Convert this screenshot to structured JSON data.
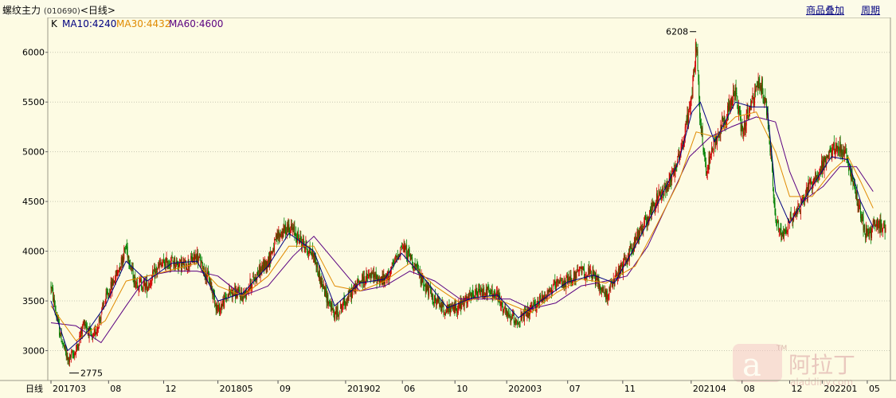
{
  "header": {
    "title_name": "螺纹主力",
    "title_code": "(010690)",
    "title_period": "<日线>",
    "link_overlay": "商品叠加",
    "link_period": "周期"
  },
  "legend": {
    "k_label": "K",
    "ma10": "MA10:4240",
    "ma30": "MA30:4432",
    "ma60": "MA60:4600"
  },
  "colors": {
    "background": "#fdfbe3",
    "up": "#d00000",
    "down": "#008000",
    "ma10": "#000080",
    "ma30": "#e08a00",
    "ma60": "#5a0080",
    "grid": "#c8c8b4"
  },
  "watermark": {
    "text": "阿拉丁",
    "url": "aladdiny.com",
    "tm": "TM"
  },
  "chart_data": {
    "type": "candlestick",
    "ylim": [
      2700,
      6350
    ],
    "ytick_values": [
      3000,
      3500,
      4000,
      4500,
      5000,
      5500,
      6000
    ],
    "ytick_labels": [
      "3000",
      "3500",
      "4000",
      "4500",
      "5000",
      "5500",
      "6000"
    ],
    "x_axis_prefix": "日线",
    "x_tick_labels": [
      {
        "label": "201703",
        "t": 0.0
      },
      {
        "label": "08",
        "t": 0.069
      },
      {
        "label": "12",
        "t": 0.135
      },
      {
        "label": "201805",
        "t": 0.2
      },
      {
        "label": "09",
        "t": 0.272
      },
      {
        "label": "201902",
        "t": 0.353
      },
      {
        "label": "06",
        "t": 0.421
      },
      {
        "label": "10",
        "t": 0.484
      },
      {
        "label": "202003",
        "t": 0.546
      },
      {
        "label": "07",
        "t": 0.619
      },
      {
        "label": "11",
        "t": 0.685
      },
      {
        "label": "202104",
        "t": 0.767
      },
      {
        "label": "08",
        "t": 0.828
      },
      {
        "label": "12",
        "t": 0.885
      },
      {
        "label": "202201",
        "t": 0.924
      },
      {
        "label": "05",
        "t": 0.978
      }
    ],
    "close_path": [
      [
        0.0,
        3650
      ],
      [
        0.01,
        3200
      ],
      [
        0.02,
        2900
      ],
      [
        0.03,
        3000
      ],
      [
        0.04,
        3300
      ],
      [
        0.05,
        3100
      ],
      [
        0.065,
        3500
      ],
      [
        0.08,
        3800
      ],
      [
        0.09,
        4050
      ],
      [
        0.1,
        3700
      ],
      [
        0.115,
        3650
      ],
      [
        0.13,
        3850
      ],
      [
        0.145,
        3900
      ],
      [
        0.16,
        3850
      ],
      [
        0.175,
        3950
      ],
      [
        0.19,
        3700
      ],
      [
        0.2,
        3400
      ],
      [
        0.215,
        3600
      ],
      [
        0.23,
        3550
      ],
      [
        0.245,
        3750
      ],
      [
        0.26,
        3900
      ],
      [
        0.272,
        4150
      ],
      [
        0.285,
        4250
      ],
      [
        0.3,
        4100
      ],
      [
        0.315,
        3950
      ],
      [
        0.325,
        3650
      ],
      [
        0.34,
        3350
      ],
      [
        0.353,
        3500
      ],
      [
        0.37,
        3700
      ],
      [
        0.385,
        3750
      ],
      [
        0.4,
        3700
      ],
      [
        0.41,
        3850
      ],
      [
        0.42,
        4050
      ],
      [
        0.43,
        3950
      ],
      [
        0.445,
        3700
      ],
      [
        0.46,
        3500
      ],
      [
        0.475,
        3400
      ],
      [
        0.49,
        3450
      ],
      [
        0.505,
        3550
      ],
      [
        0.52,
        3600
      ],
      [
        0.535,
        3550
      ],
      [
        0.546,
        3350
      ],
      [
        0.56,
        3300
      ],
      [
        0.575,
        3400
      ],
      [
        0.59,
        3550
      ],
      [
        0.605,
        3650
      ],
      [
        0.619,
        3700
      ],
      [
        0.635,
        3800
      ],
      [
        0.65,
        3750
      ],
      [
        0.665,
        3550
      ],
      [
        0.675,
        3700
      ],
      [
        0.685,
        3850
      ],
      [
        0.7,
        4100
      ],
      [
        0.712,
        4300
      ],
      [
        0.725,
        4500
      ],
      [
        0.74,
        4700
      ],
      [
        0.752,
        4950
      ],
      [
        0.76,
        5200
      ],
      [
        0.768,
        5600
      ],
      [
        0.773,
        6100
      ],
      [
        0.778,
        5300
      ],
      [
        0.785,
        4800
      ],
      [
        0.795,
        5100
      ],
      [
        0.81,
        5400
      ],
      [
        0.82,
        5600
      ],
      [
        0.828,
        5200
      ],
      [
        0.84,
        5500
      ],
      [
        0.85,
        5700
      ],
      [
        0.858,
        5400
      ],
      [
        0.863,
        4900
      ],
      [
        0.868,
        4300
      ],
      [
        0.875,
        4150
      ],
      [
        0.885,
        4300
      ],
      [
        0.9,
        4500
      ],
      [
        0.912,
        4700
      ],
      [
        0.924,
        4850
      ],
      [
        0.935,
        5000
      ],
      [
        0.945,
        5050
      ],
      [
        0.955,
        4900
      ],
      [
        0.963,
        4600
      ],
      [
        0.97,
        4400
      ],
      [
        0.975,
        4200
      ],
      [
        0.98,
        4150
      ],
      [
        0.985,
        4250
      ]
    ],
    "ma10_path": [
      [
        0.0,
        3500
      ],
      [
        0.02,
        3000
      ],
      [
        0.04,
        3150
      ],
      [
        0.065,
        3450
      ],
      [
        0.09,
        3900
      ],
      [
        0.115,
        3700
      ],
      [
        0.145,
        3880
      ],
      [
        0.175,
        3900
      ],
      [
        0.2,
        3500
      ],
      [
        0.23,
        3580
      ],
      [
        0.26,
        3850
      ],
      [
        0.285,
        4180
      ],
      [
        0.315,
        4000
      ],
      [
        0.34,
        3450
      ],
      [
        0.37,
        3680
      ],
      [
        0.4,
        3720
      ],
      [
        0.42,
        3980
      ],
      [
        0.445,
        3750
      ],
      [
        0.475,
        3430
      ],
      [
        0.505,
        3530
      ],
      [
        0.535,
        3560
      ],
      [
        0.56,
        3330
      ],
      [
        0.59,
        3520
      ],
      [
        0.619,
        3690
      ],
      [
        0.65,
        3760
      ],
      [
        0.675,
        3680
      ],
      [
        0.7,
        4050
      ],
      [
        0.725,
        4450
      ],
      [
        0.752,
        4900
      ],
      [
        0.768,
        5400
      ],
      [
        0.778,
        5500
      ],
      [
        0.795,
        5100
      ],
      [
        0.82,
        5500
      ],
      [
        0.84,
        5450
      ],
      [
        0.858,
        5450
      ],
      [
        0.868,
        4600
      ],
      [
        0.885,
        4280
      ],
      [
        0.912,
        4650
      ],
      [
        0.935,
        4950
      ],
      [
        0.955,
        4920
      ],
      [
        0.97,
        4500
      ],
      [
        0.985,
        4240
      ]
    ],
    "ma30_path": [
      [
        0.0,
        3450
      ],
      [
        0.03,
        3100
      ],
      [
        0.065,
        3300
      ],
      [
        0.09,
        3700
      ],
      [
        0.13,
        3780
      ],
      [
        0.175,
        3880
      ],
      [
        0.2,
        3650
      ],
      [
        0.23,
        3550
      ],
      [
        0.26,
        3750
      ],
      [
        0.285,
        4050
      ],
      [
        0.315,
        4050
      ],
      [
        0.34,
        3650
      ],
      [
        0.37,
        3600
      ],
      [
        0.4,
        3700
      ],
      [
        0.43,
        3880
      ],
      [
        0.46,
        3650
      ],
      [
        0.49,
        3480
      ],
      [
        0.52,
        3550
      ],
      [
        0.546,
        3480
      ],
      [
        0.575,
        3380
      ],
      [
        0.605,
        3580
      ],
      [
        0.635,
        3720
      ],
      [
        0.665,
        3680
      ],
      [
        0.7,
        3850
      ],
      [
        0.725,
        4250
      ],
      [
        0.752,
        4700
      ],
      [
        0.773,
        5200
      ],
      [
        0.795,
        5150
      ],
      [
        0.82,
        5350
      ],
      [
        0.845,
        5400
      ],
      [
        0.868,
        5000
      ],
      [
        0.885,
        4550
      ],
      [
        0.912,
        4550
      ],
      [
        0.935,
        4800
      ],
      [
        0.955,
        4950
      ],
      [
        0.97,
        4700
      ],
      [
        0.985,
        4432
      ]
    ],
    "ma60_path": [
      [
        0.0,
        3280
      ],
      [
        0.03,
        3250
      ],
      [
        0.06,
        3080
      ],
      [
        0.09,
        3450
      ],
      [
        0.115,
        3750
      ],
      [
        0.145,
        3800
      ],
      [
        0.175,
        3800
      ],
      [
        0.2,
        3750
      ],
      [
        0.23,
        3550
      ],
      [
        0.26,
        3650
      ],
      [
        0.29,
        3950
      ],
      [
        0.315,
        4150
      ],
      [
        0.34,
        3900
      ],
      [
        0.37,
        3600
      ],
      [
        0.4,
        3650
      ],
      [
        0.43,
        3800
      ],
      [
        0.46,
        3700
      ],
      [
        0.49,
        3520
      ],
      [
        0.52,
        3520
      ],
      [
        0.55,
        3520
      ],
      [
        0.575,
        3420
      ],
      [
        0.605,
        3480
      ],
      [
        0.635,
        3650
      ],
      [
        0.665,
        3700
      ],
      [
        0.69,
        3750
      ],
      [
        0.715,
        4050
      ],
      [
        0.74,
        4500
      ],
      [
        0.765,
        4950
      ],
      [
        0.79,
        5150
      ],
      [
        0.815,
        5250
      ],
      [
        0.845,
        5350
      ],
      [
        0.868,
        5300
      ],
      [
        0.885,
        4800
      ],
      [
        0.9,
        4500
      ],
      [
        0.925,
        4650
      ],
      [
        0.945,
        4850
      ],
      [
        0.965,
        4850
      ],
      [
        0.985,
        4600
      ]
    ],
    "annotations": [
      {
        "text": "6208",
        "t": 0.773,
        "value": 6208,
        "side": "left"
      },
      {
        "text": "2775",
        "t": 0.022,
        "value": 2775,
        "side": "right"
      }
    ]
  }
}
